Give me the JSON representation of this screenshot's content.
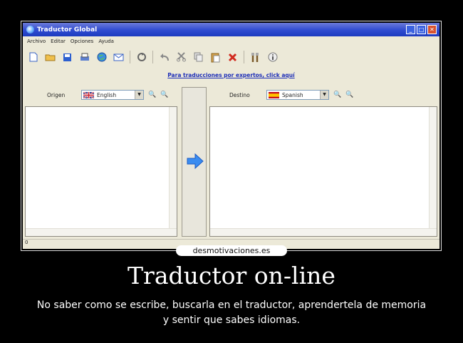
{
  "window": {
    "title": "Traductor Global",
    "controls": [
      "_",
      "□",
      "✕"
    ]
  },
  "menu": [
    "Archivo",
    "Editar",
    "Opciones",
    "Ayuda"
  ],
  "toolbar": {
    "icons": [
      "new-document-icon",
      "open-folder-icon",
      "save-icon",
      "print-icon",
      "globe-icon",
      "mail-icon",
      "convert-icon",
      "undo-icon",
      "cut-icon",
      "copy-icon",
      "paste-icon",
      "delete-icon",
      "settings-icon",
      "info-icon"
    ]
  },
  "link_text": "Para traducciones por expertos, click aquí",
  "source": {
    "label": "Origen",
    "language": "English"
  },
  "target": {
    "label": "Destino",
    "language": "Spanish"
  },
  "status_text": "0",
  "watermark": "desmotivaciones.es",
  "poster": {
    "title": "Traductor on-line",
    "subtitle": "No saber como se escribe, buscarla en el traductor, aprendertela de memoria y sentir que sabes idiomas."
  },
  "colors": {
    "titlebar": "#2f4bd0",
    "link": "#1e2fb8",
    "arrow": "#3a8cf0",
    "background": "#000000"
  }
}
